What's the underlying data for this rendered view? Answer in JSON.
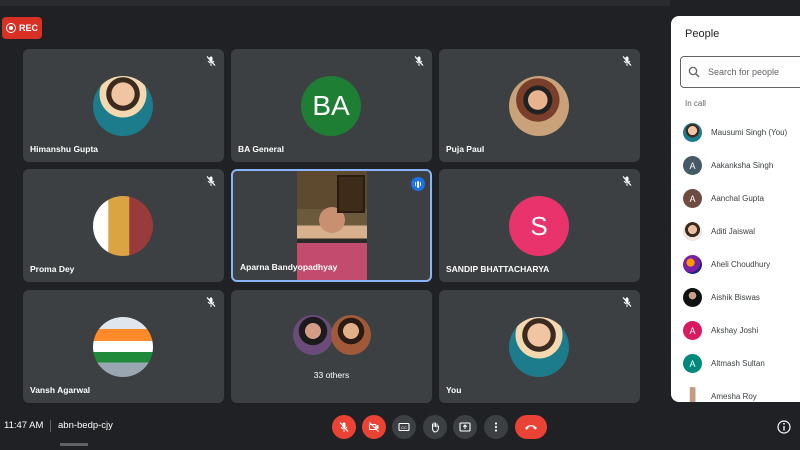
{
  "top_fragment": "· - · · · · · ·",
  "rec_label": "REC",
  "tiles": {
    "himanshu": {
      "name": "Himanshu Gupta"
    },
    "ba": {
      "name": "BA General",
      "initials": "BA",
      "color": "#1e7e34"
    },
    "puja": {
      "name": "Puja Paul"
    },
    "proma": {
      "name": "Proma Dey"
    },
    "aparna": {
      "name": "Aparna Bandyopadhyay"
    },
    "sandip": {
      "name": "SANDIP BHATTACHARYA",
      "initial": "S",
      "color": "#e8336d"
    },
    "vansh": {
      "name": "Vansh Agarwal"
    },
    "others": {
      "label": "33 others"
    },
    "you": {
      "name": "You"
    }
  },
  "people_panel": {
    "title": "People",
    "search_placeholder": "Search for people",
    "section": "In call",
    "participants": [
      {
        "name": "Mausumi Singh (You)",
        "avatar": "photo",
        "color": "#8d6e63"
      },
      {
        "name": "Aakanksha Singh",
        "avatar": "A",
        "color": "#455a64"
      },
      {
        "name": "Aanchal Gupta",
        "avatar": "A",
        "color": "#6d4c41"
      },
      {
        "name": "Aditi Jaiswal",
        "avatar": "photo",
        "color": "#d7ccc8"
      },
      {
        "name": "Aheli Choudhury",
        "avatar": "photo",
        "color": "#4a148c"
      },
      {
        "name": "Aishik Biswas",
        "avatar": "photo",
        "color": "#263238"
      },
      {
        "name": "Akshay Joshi",
        "avatar": "A",
        "color": "#d81b60"
      },
      {
        "name": "Altmash Sultan",
        "avatar": "A",
        "color": "#00897b"
      },
      {
        "name": "Amesha Roy",
        "avatar": "photo",
        "color": "#bcaaa4"
      }
    ]
  },
  "bottom_bar": {
    "time": "11:47 AM",
    "meeting_code": "abn-bedp-cjy"
  },
  "colors": {
    "background": "#202124",
    "tile": "#3c4043",
    "danger": "#ea4335",
    "accent": "#1a73e8"
  }
}
